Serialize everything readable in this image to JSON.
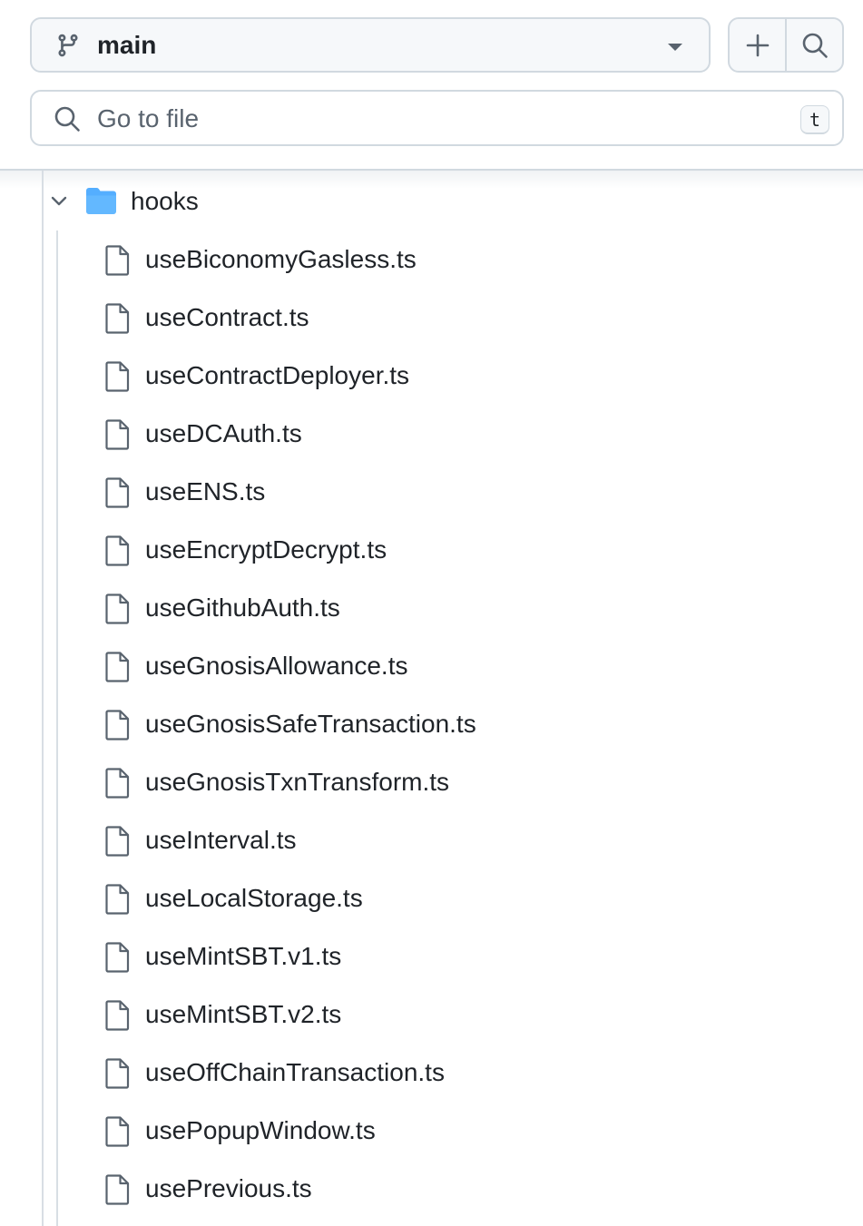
{
  "branch_selector": {
    "label": "main",
    "icon": "git-branch-icon",
    "dropdown_icon": "triangle-down-icon"
  },
  "actions": {
    "add_icon": "plus-icon",
    "search_icon": "search-icon"
  },
  "file_search": {
    "placeholder": "Go to file",
    "shortcut_key": "t"
  },
  "tree": {
    "folder": {
      "name": "hooks",
      "expanded": true,
      "icon": "folder-open-icon",
      "icon_color": "#54aeff"
    },
    "files": [
      "useBiconomyGasless.ts",
      "useContract.ts",
      "useContractDeployer.ts",
      "useDCAuth.ts",
      "useENS.ts",
      "useEncryptDecrypt.ts",
      "useGithubAuth.ts",
      "useGnosisAllowance.ts",
      "useGnosisSafeTransaction.ts",
      "useGnosisTxnTransform.ts",
      "useInterval.ts",
      "useLocalStorage.ts",
      "useMintSBT.v1.ts",
      "useMintSBT.v2.ts",
      "useOffChainTransaction.ts",
      "usePopupWindow.ts",
      "usePrevious.ts"
    ]
  },
  "colors": {
    "text": "#1f2328",
    "muted_text": "#59636e",
    "border": "#d1d9e0",
    "button_bg": "#f6f8fa",
    "icon": "#59636e"
  }
}
